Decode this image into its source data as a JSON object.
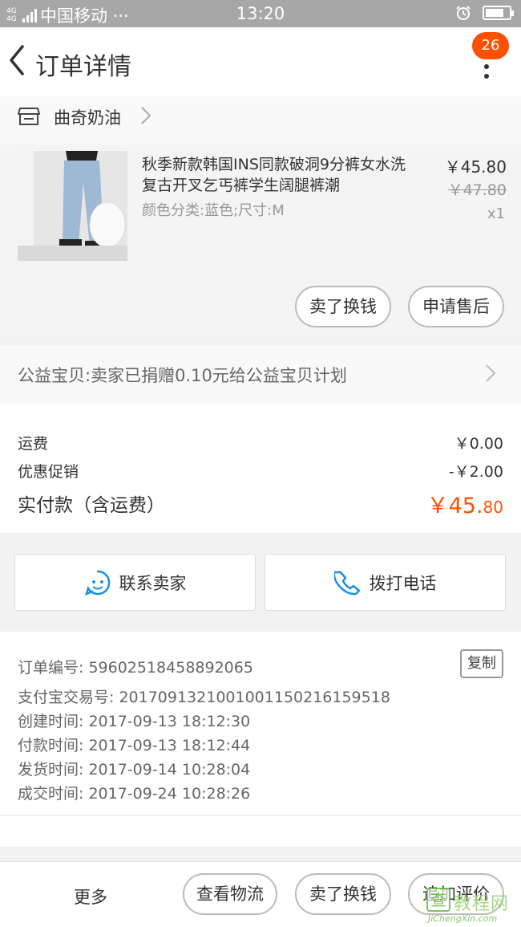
{
  "status_bar": {
    "net": "4G 4G",
    "carrier": "中国移动 ···",
    "time": "13:20",
    "battery_level": 0.8
  },
  "header": {
    "title": "订单详情",
    "badge_count": "26"
  },
  "shop": {
    "name": "曲奇奶油"
  },
  "product": {
    "title": "秋季新款韩国INS同款破洞9分裤女水洗复古开叉乞丐裤学生阔腿裤潮",
    "spec": "颜色分类:蓝色;尺寸:M",
    "price": "￥45.80",
    "original_price": "￥47.80",
    "quantity": "x1",
    "sell_button": "卖了换钱",
    "aftersale_button": "申请售后"
  },
  "charity": {
    "text": "公益宝贝:卖家已捐赠0.10元给公益宝贝计划"
  },
  "fees": {
    "shipping_label": "运费",
    "shipping_value": "￥0.00",
    "discount_label": "优惠促销",
    "discount_value": "-￥2.00",
    "total_label": "实付款（含运费）",
    "total_value_main": "￥45.",
    "total_value_cents": "80"
  },
  "contact": {
    "seller_label": "联系卖家",
    "phone_label": "拨打电话"
  },
  "order_info": {
    "order_no": "订单编号: 59602518458892065",
    "copy_label": "复制",
    "alipay_no": "支付宝交易号: 2017091321001001150216159518",
    "created": "创建时间: 2017-09-13 18:12:30",
    "paid": "付款时间: 2017-09-13 18:12:44",
    "shipped": "发货时间: 2017-09-14 10:28:04",
    "completed": "成交时间: 2017-09-24 10:28:26"
  },
  "bottom_bar": {
    "more": "更多",
    "logistics": "查看物流",
    "sell": "卖了换钱",
    "review": "追加评价"
  },
  "watermark": {
    "mark": "查",
    "cn": "教程网",
    "url": "JiChengXin.com"
  },
  "colors": {
    "accent": "#ff5000",
    "link_blue": "#1a8fe8"
  }
}
